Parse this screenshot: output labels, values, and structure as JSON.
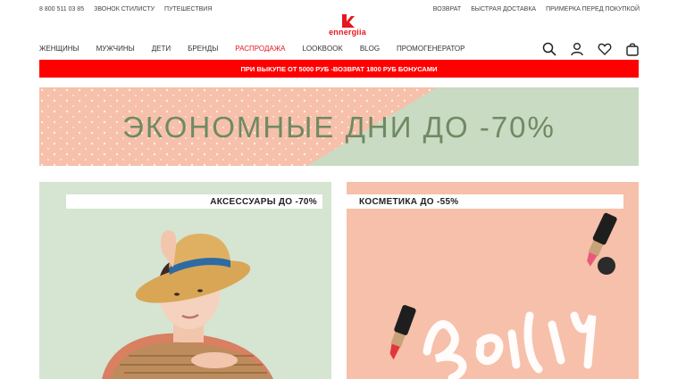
{
  "topbar": {
    "phone": "8 800 511 03 85",
    "stylist_call": "ЗВОНОК СТИЛИСТУ",
    "travel": "ПУТЕШЕСТВИЯ",
    "return": "ВОЗВРАТ",
    "fast_delivery": "БЫСТРАЯ ДОСТАВКА",
    "fitting": "ПРИМЕРКА ПЕРЕД ПОКУПКОЙ"
  },
  "logo": {
    "text": "ennergiia"
  },
  "nav": {
    "items": [
      "ЖЕНЩИНЫ",
      "МУЖЧИНЫ",
      "ДЕТИ",
      "БРЕНДЫ",
      "РАСПРОДАЖА",
      "LOOKBOOK",
      "BLOG",
      "ПРОМОГЕНЕРАТОР"
    ]
  },
  "header_icons": [
    "search-icon",
    "account-icon",
    "heart-icon",
    "bag-icon"
  ],
  "promo_bar": {
    "text": "ПРИ ВЫКУПЕ ОТ 5000 РУБ -ВОЗВРАТ 1800 РУБ БОНУСАМИ"
  },
  "hero": {
    "title": "ЭКОНОМНЫЕ ДНИ ДО -70%"
  },
  "cards": [
    {
      "label": "АКСЕССУАРЫ ДО -70%"
    },
    {
      "label": "КОСМЕТИКА ДО -55%",
      "art_text": "Beauty"
    }
  ],
  "colors": {
    "brand_red": "#e5171f",
    "promo_red": "#ff0000",
    "hero_peach": "#f6c0aa",
    "hero_green": "#c9dbc3",
    "hero_text": "#6f8a63"
  }
}
